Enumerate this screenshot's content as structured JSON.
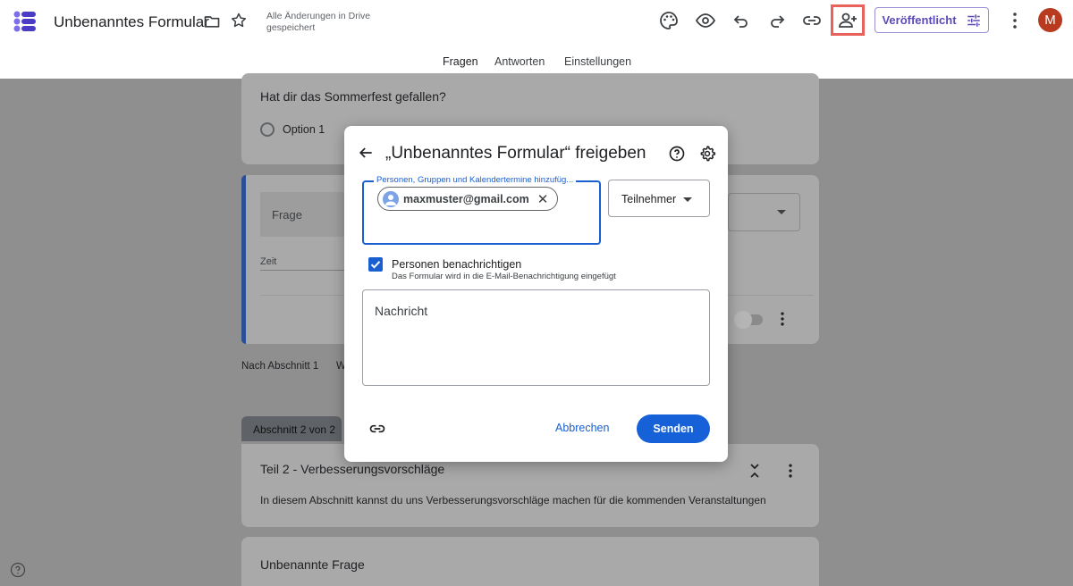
{
  "header": {
    "title": "Unbenanntes Formular",
    "save_status": "Alle Änderungen in Drive gespeichert",
    "publish_label": "Veröffentlicht",
    "avatar_letter": "M",
    "toolbar_icons": [
      "palette-icon",
      "preview-icon",
      "undo-icon",
      "redo-icon",
      "link-icon",
      "add-person-icon"
    ]
  },
  "tabs": [
    {
      "label": "Fragen",
      "active": true
    },
    {
      "label": "Antworten",
      "active": false
    },
    {
      "label": "Einstellungen",
      "active": false
    }
  ],
  "background_form": {
    "question_title": "Hat dir das Sommerfest gefallen?",
    "option_1": "Option 1",
    "question_placeholder": "Frage",
    "time_label": "Zeit",
    "after_section": "Nach Abschnitt 1",
    "after_section_cut": "W",
    "section_tab": "Abschnitt 2 von 2",
    "section_title": "Teil 2 - Verbesserungsvorschläge",
    "section_description": "In diesem Abschnitt kannst du uns Verbesserungsvorschläge machen für die kommenden Veranstaltungen",
    "untitled_question": "Unbenannte Frage"
  },
  "dialog": {
    "title": "„Unbenanntes Formular“ freigeben",
    "people_label": "Personen, Gruppen und Kalendertermine hinzufüg...",
    "chip_email": "maxmuster@gmail.com",
    "role": "Teilnehmer",
    "notify_checked": true,
    "notify_label": "Personen benachrichtigen",
    "notify_sub": "Das Formular wird in die E-Mail-Benachrichtigung eingefügt",
    "message_placeholder": "Nachricht",
    "cancel_label": "Abbrechen",
    "send_label": "Senden"
  },
  "colors": {
    "accent": "#1a5fd0",
    "publish": "#5b4bb6",
    "avatar": "#b83a1f",
    "highlight": "#e8615a"
  }
}
